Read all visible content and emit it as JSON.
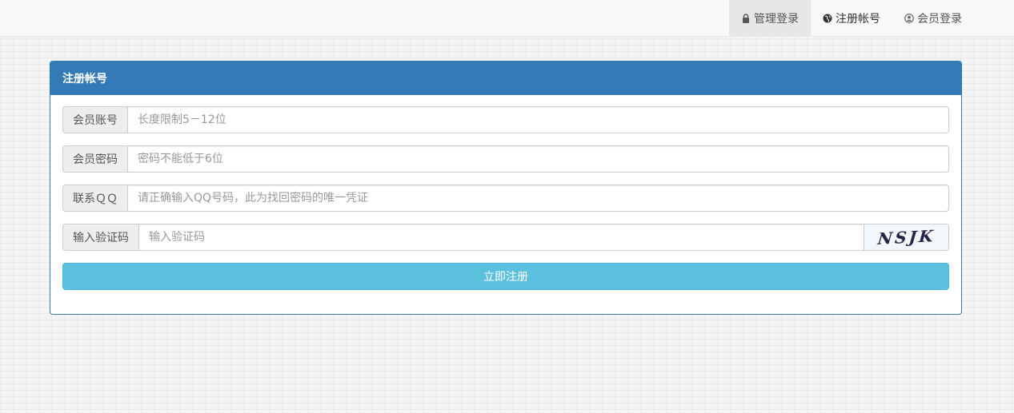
{
  "nav": {
    "items": [
      {
        "label": "管理登录",
        "icon": "lock-icon"
      },
      {
        "label": "注册帐号",
        "icon": "globe-icon"
      },
      {
        "label": "会员登录",
        "icon": "user-circle-icon"
      }
    ]
  },
  "panel": {
    "title": "注册帐号"
  },
  "form": {
    "account": {
      "label": "会员账号",
      "placeholder": "长度限制5－12位"
    },
    "password": {
      "label": "会员密码",
      "placeholder": "密码不能低于6位"
    },
    "qq": {
      "label": "联系ＱＱ",
      "placeholder": "请正确输入QQ号码，此为找回密码的唯一凭证"
    },
    "captcha": {
      "label": "输入验证码",
      "placeholder": "输入验证码",
      "image_text": "NSJK"
    },
    "submit_label": "立即注册"
  },
  "colors": {
    "primary": "#337ab7",
    "info": "#5bc0de"
  }
}
